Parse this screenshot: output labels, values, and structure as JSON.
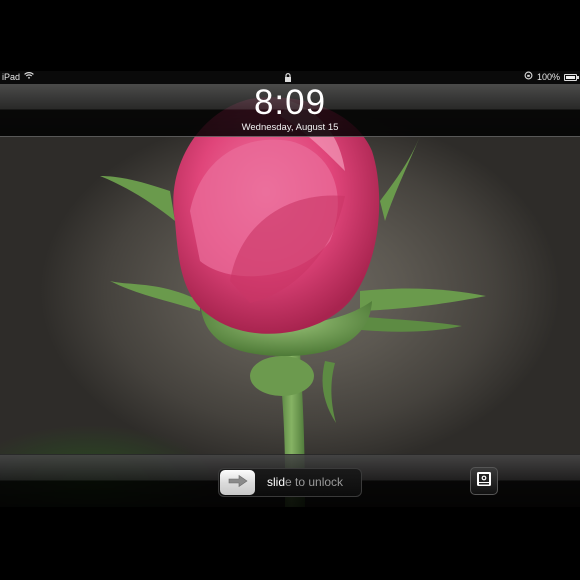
{
  "status_bar": {
    "device": "iPad",
    "battery_percent": "100%",
    "icons": [
      "wifi-icon",
      "lock-icon",
      "rotation-lock-icon",
      "battery-icon"
    ]
  },
  "lock_screen": {
    "time": "8:09",
    "date": "Wednesday, August 15"
  },
  "unlock_slider": {
    "label_lit": "slid",
    "label_rest": "e to unlock",
    "knob_icon": "arrow-right-icon"
  },
  "picture_frame_button": {
    "icon": "picture-frame-icon"
  },
  "colors": {
    "petal_pink": "#e0457a",
    "stem_green": "#6a9a4c"
  }
}
